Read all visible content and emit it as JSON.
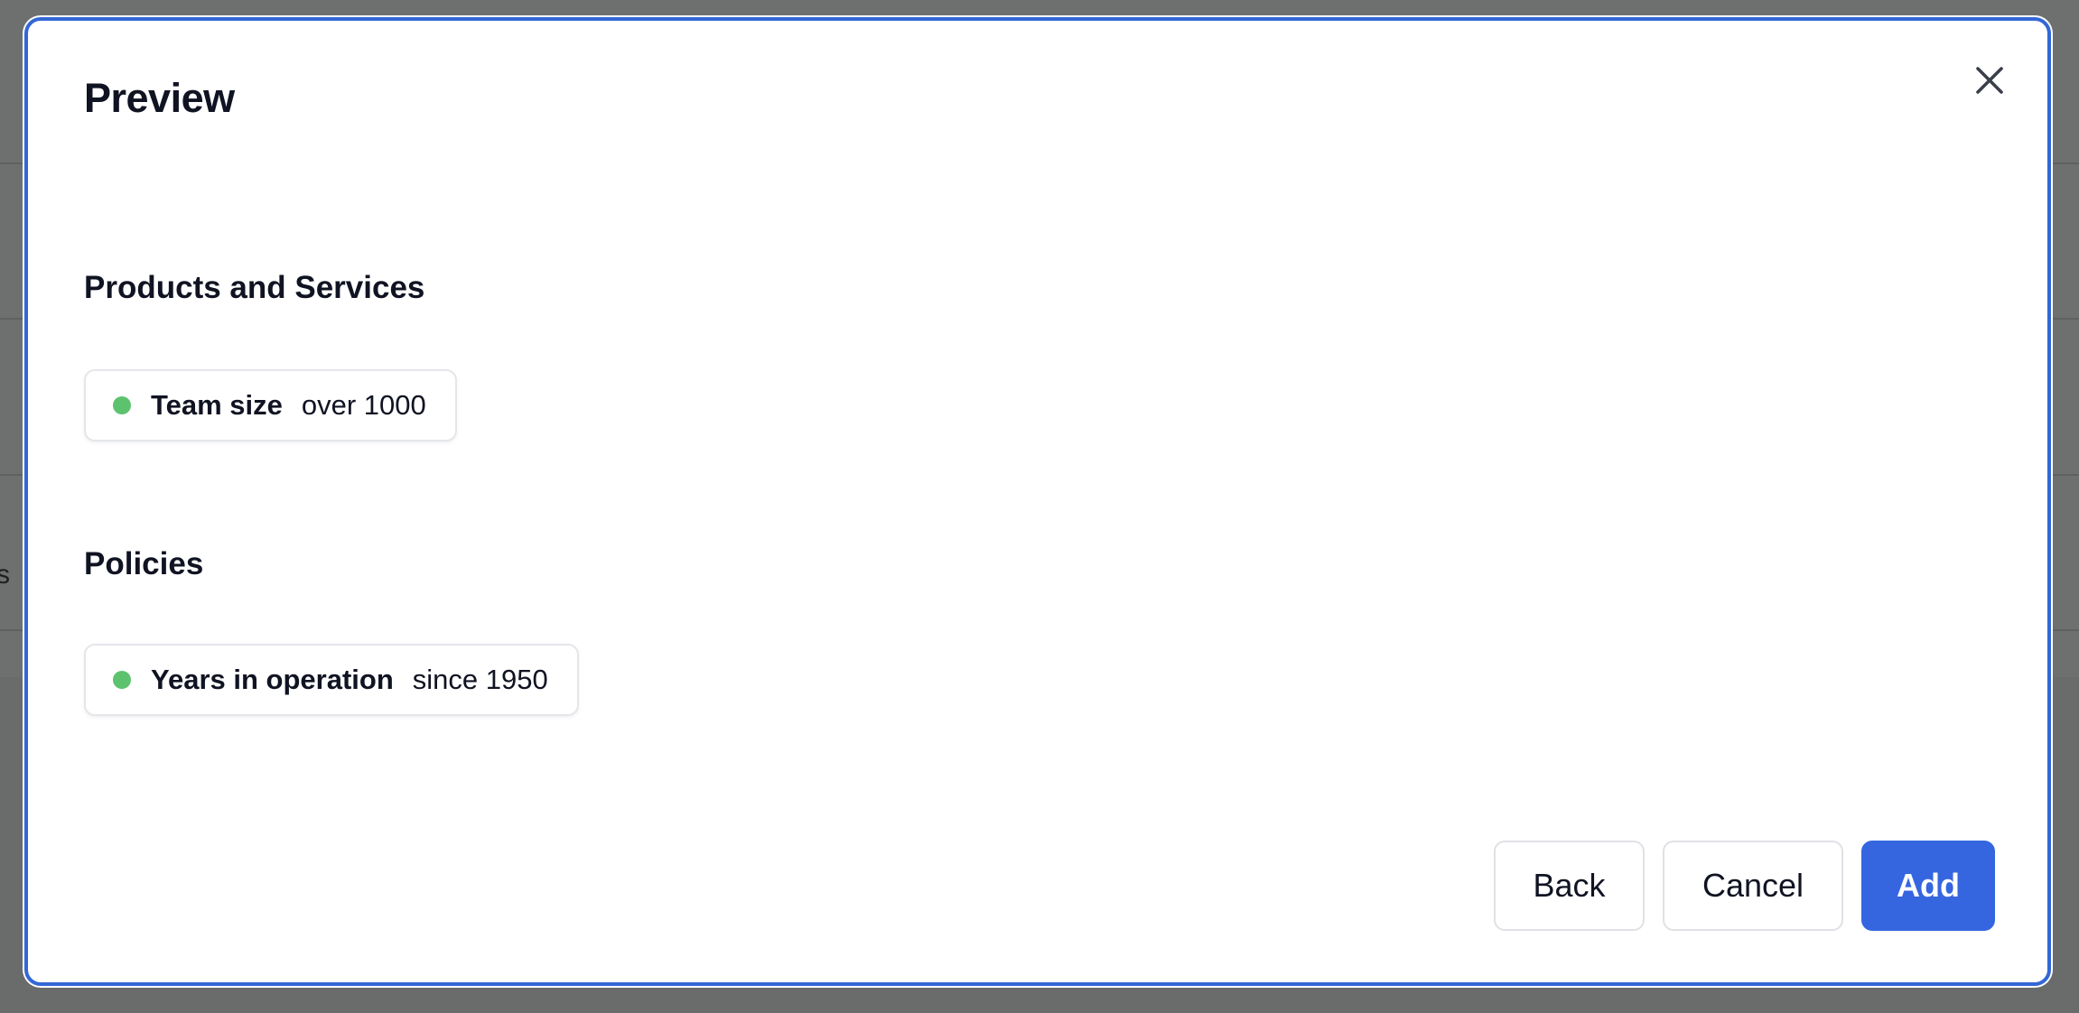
{
  "background": {
    "partial_text": "s c"
  },
  "dialog": {
    "title": "Preview",
    "close_icon": "close-icon",
    "sections": [
      {
        "title": "Products and Services",
        "items": [
          {
            "label": "Team size",
            "value": "over 1000",
            "status_color": "#5cc26e"
          }
        ]
      },
      {
        "title": "Policies",
        "items": [
          {
            "label": "Years in operation",
            "value": "since 1950",
            "status_color": "#5cc26e"
          }
        ]
      }
    ],
    "buttons": {
      "back": "Back",
      "cancel": "Cancel",
      "add": "Add"
    },
    "accent_color": "#3566e0"
  }
}
